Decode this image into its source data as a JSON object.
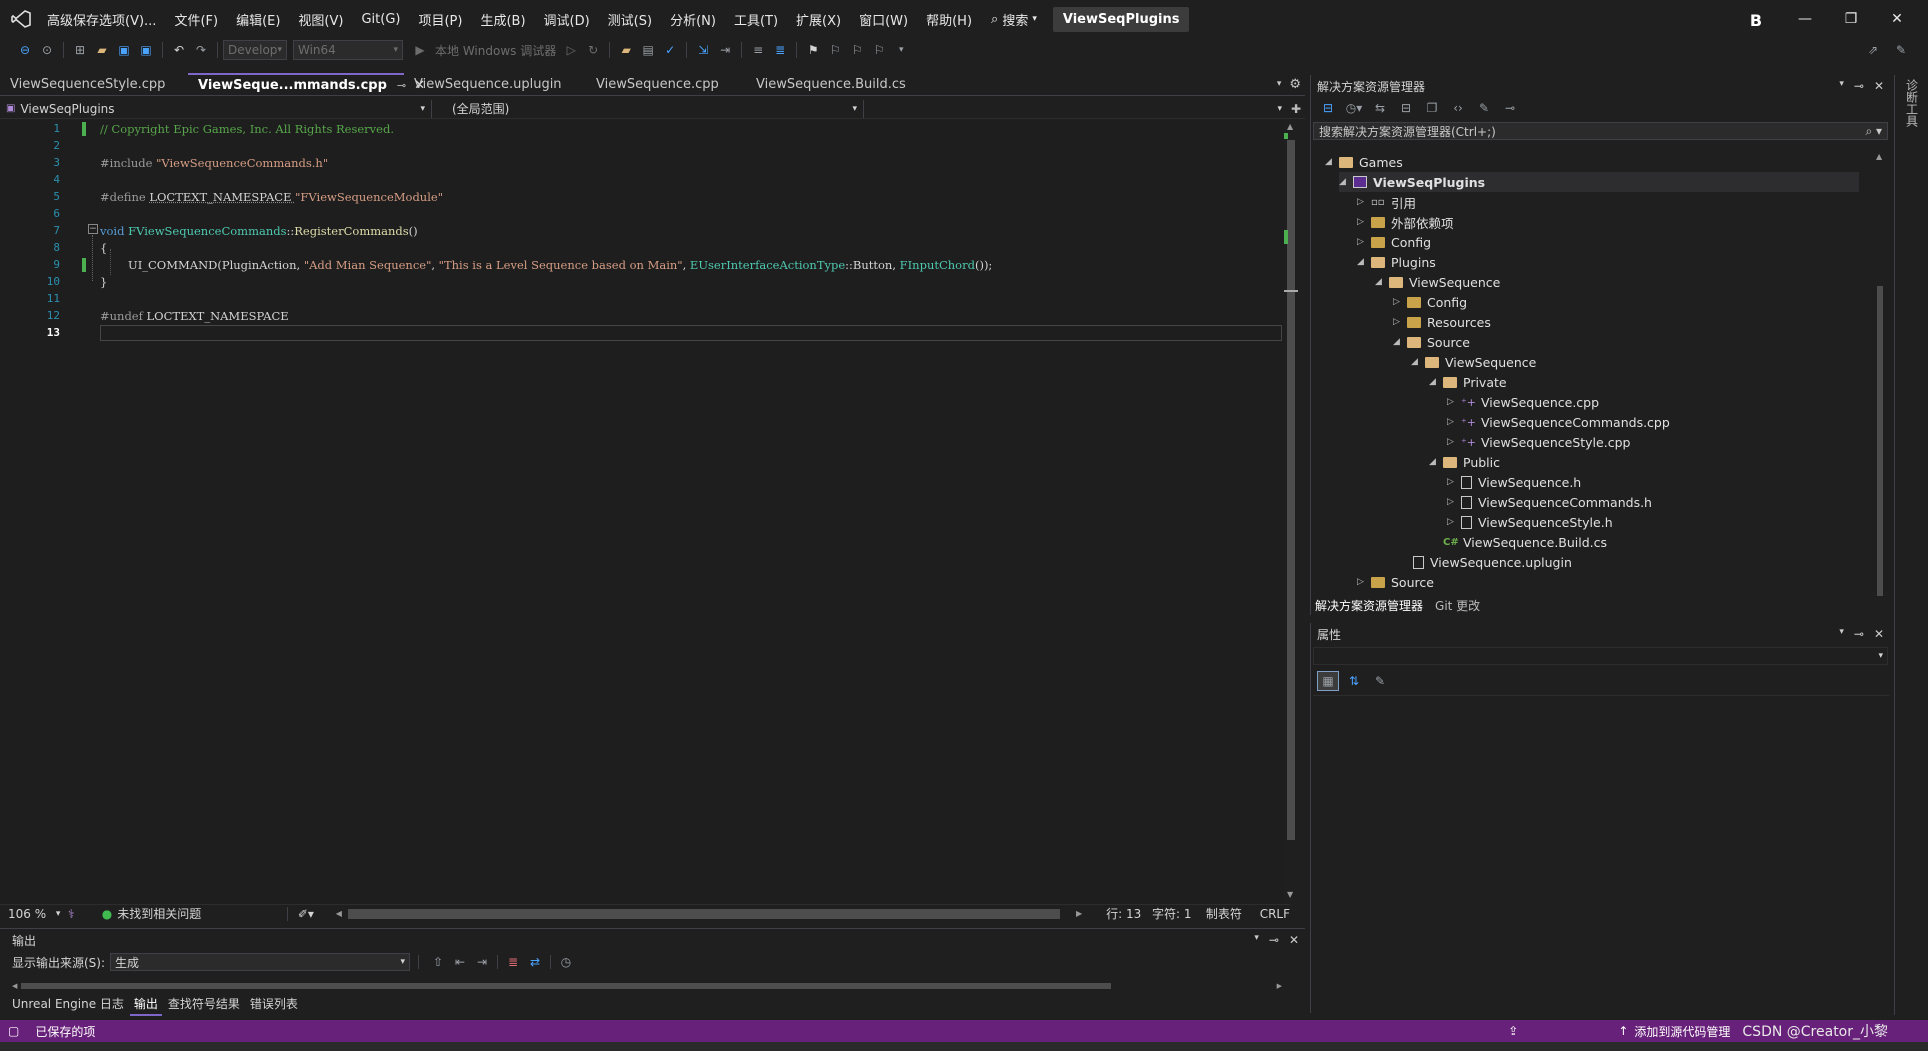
{
  "title_bar": {
    "menus": [
      "高级保存选项(V)...",
      "文件(F)",
      "编辑(E)",
      "视图(V)",
      "Git(G)",
      "项目(P)",
      "生成(B)",
      "调试(D)",
      "测试(S)",
      "分析(N)",
      "工具(T)",
      "扩展(X)",
      "窗口(W)",
      "帮助(H)"
    ],
    "search_label": "搜索",
    "project_name": "ViewSeqPlugins",
    "avatar_letter": "B"
  },
  "toolbar": {
    "config_combo": "Develop",
    "platform_combo": "Win64",
    "debug_target": "本地 Windows 调试器"
  },
  "editor_tabs": [
    {
      "label": "ViewSequenceStyle.cpp",
      "active": false
    },
    {
      "label": "ViewSeque...mmands.cpp",
      "active": true
    },
    {
      "label": "ViewSequence.uplugin",
      "active": false
    },
    {
      "label": "ViewSequence.cpp",
      "active": false
    },
    {
      "label": "ViewSequence.Build.cs",
      "active": false
    }
  ],
  "navbar": {
    "project": "ViewSeqPlugins",
    "scope": "(全局范围)"
  },
  "code": {
    "line_numbers": [
      "1",
      "2",
      "3",
      "4",
      "5",
      "6",
      "7",
      "8",
      "9",
      "10",
      "11",
      "12",
      "13"
    ],
    "lines": {
      "l1": "// Copyright Epic Games, Inc. All Rights Reserved.",
      "l3_pp": "#include ",
      "l3_str": "\"ViewSequenceCommands.h\"",
      "l5_pp": "#define ",
      "l5_mac": "LOCTEXT_NAMESPACE ",
      "l5_str": "\"FViewSequenceModule\"",
      "l7_kw": "void ",
      "l7_ty": "FViewSequenceCommands",
      "l7_sep": "::",
      "l7_fn": "RegisterCommands",
      "l7_paren": "()",
      "l8": "{",
      "l9_mac": "UI_COMMAND",
      "l9_a": "(PluginAction, ",
      "l9_s1": "\"Add Mian Sequence\"",
      "l9_b": ", ",
      "l9_s2": "\"This is a Level Sequence based on Main\"",
      "l9_c": ", ",
      "l9_ty": "EUserInterfaceActionType",
      "l9_d": "::Button, ",
      "l9_fn": "FInputChord",
      "l9_e": "());",
      "l10": "}",
      "l12_pp": "#undef ",
      "l12_mac": "LOCTEXT_NAMESPACE"
    }
  },
  "editor_status": {
    "zoom": "106 %",
    "issues": "未找到相关问题",
    "line": "行: 13",
    "char": "字符: 1",
    "indent": "制表符",
    "eol": "CRLF"
  },
  "output_panel": {
    "title": "输出",
    "source_label": "显示输出来源(S):",
    "source_value": "生成",
    "tabs": [
      "Unreal Engine 日志",
      "输出",
      "查找符号结果",
      "错误列表"
    ]
  },
  "solution_explorer": {
    "title": "解决方案资源管理器",
    "search_placeholder": "搜索解决方案资源管理器(Ctrl+;)",
    "tree": [
      {
        "label": "Games",
        "kind": "folder"
      },
      {
        "label": "ViewSeqPlugins",
        "kind": "project"
      },
      {
        "label": "引用",
        "kind": "ref"
      },
      {
        "label": "外部依赖项",
        "kind": "folder"
      },
      {
        "label": "Config",
        "kind": "folder"
      },
      {
        "label": "Plugins",
        "kind": "folder"
      },
      {
        "label": "ViewSequence",
        "kind": "folder"
      },
      {
        "label": "Config",
        "kind": "folder"
      },
      {
        "label": "Resources",
        "kind": "folder"
      },
      {
        "label": "Source",
        "kind": "folder"
      },
      {
        "label": "ViewSequence",
        "kind": "folder"
      },
      {
        "label": "Private",
        "kind": "folder"
      },
      {
        "label": "ViewSequence.cpp",
        "kind": "cpp"
      },
      {
        "label": "ViewSequenceCommands.cpp",
        "kind": "cpp"
      },
      {
        "label": "ViewSequenceStyle.cpp",
        "kind": "cpp"
      },
      {
        "label": "Public",
        "kind": "folder"
      },
      {
        "label": "ViewSequence.h",
        "kind": "h"
      },
      {
        "label": "ViewSequenceCommands.h",
        "kind": "h"
      },
      {
        "label": "ViewSequenceStyle.h",
        "kind": "h"
      },
      {
        "label": "ViewSequence.Build.cs",
        "kind": "cs"
      },
      {
        "label": "ViewSequence.uplugin",
        "kind": "file"
      },
      {
        "label": "Source",
        "kind": "folder"
      }
    ],
    "bottom_tabs": [
      "解决方案资源管理器",
      "Git 更改"
    ]
  },
  "properties_panel": {
    "title": "属性"
  },
  "side_strip_label": "诊断工具",
  "status_bar": {
    "saved": "已保存的项",
    "add_source": "添加到源代码管理"
  },
  "watermark": "CSDN @Creator_小黎"
}
